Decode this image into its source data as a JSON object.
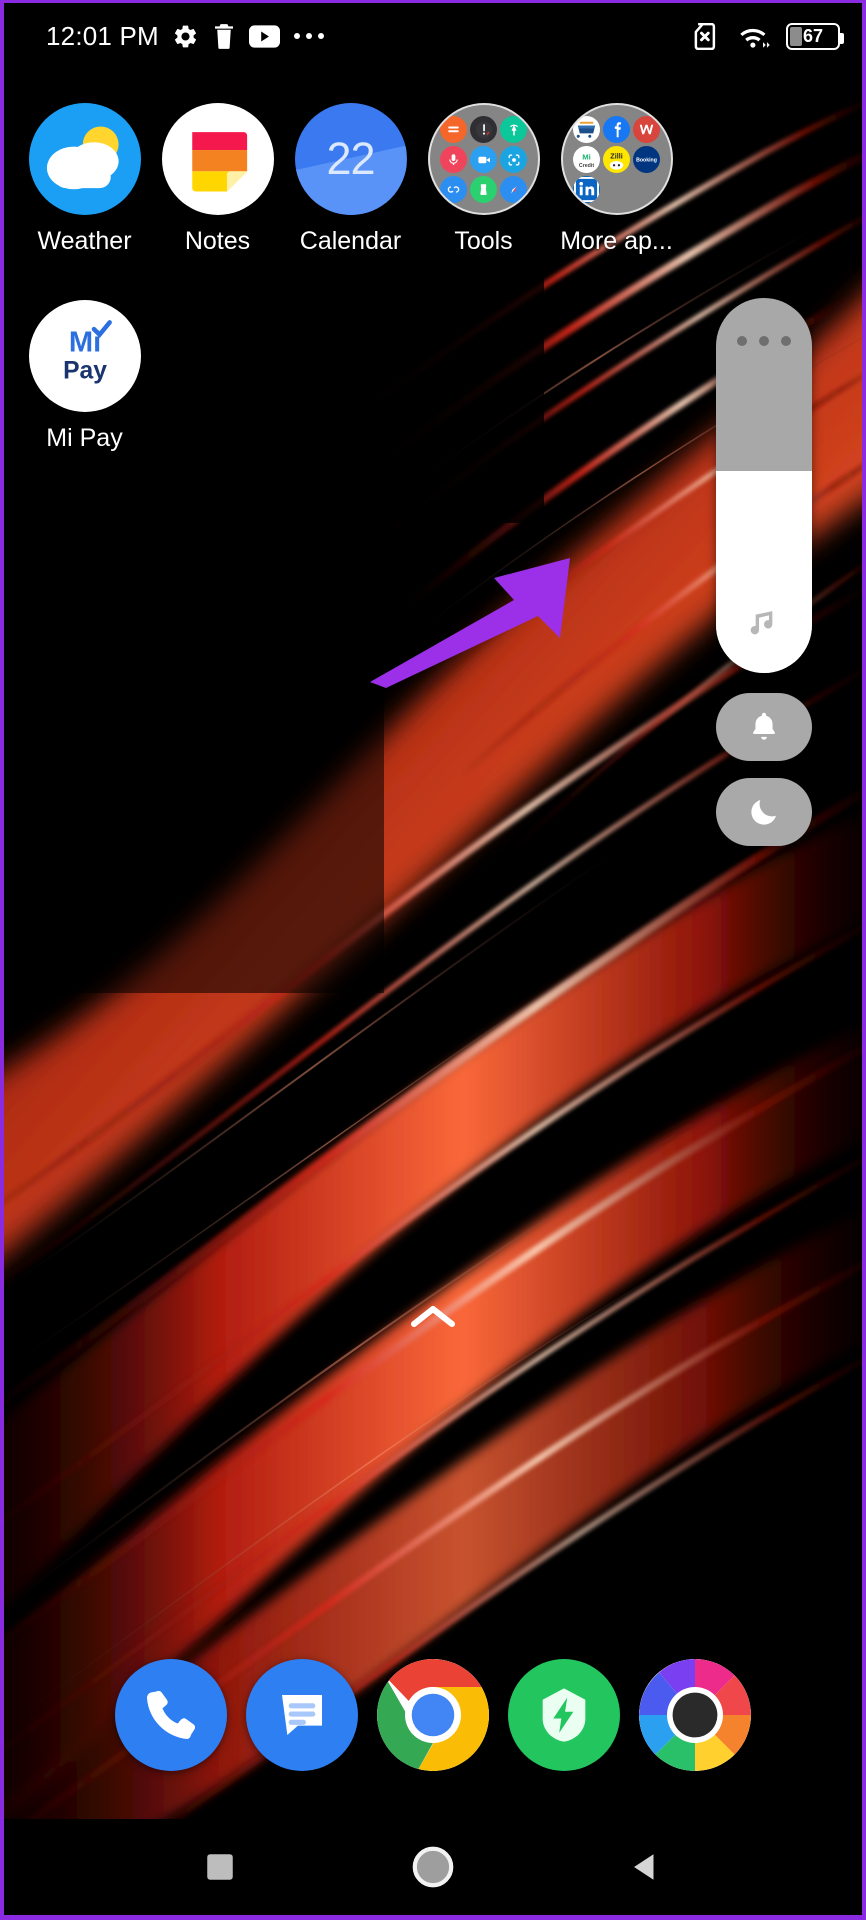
{
  "status_bar": {
    "time": "12:01 PM",
    "left_icons": [
      "gear-icon",
      "trash-icon",
      "youtube-icon",
      "more-dots-icon"
    ],
    "right_icons": [
      "no-sim-icon",
      "wifi-icon"
    ],
    "battery_level": "67"
  },
  "home_screen": {
    "apps": [
      {
        "label": "Weather",
        "icon": "weather-icon",
        "bg": "#1a9ff5"
      },
      {
        "label": "Notes",
        "icon": "notes-icon",
        "bg": "#ffffff"
      },
      {
        "label": "Calendar",
        "icon": "calendar-icon",
        "bg": "#4285f4",
        "day": "22"
      },
      {
        "label": "Tools",
        "icon": "folder-tools",
        "bg": "#d2d2d2"
      },
      {
        "label": "More ap...",
        "icon": "folder-more-apps",
        "bg": "#d2d2d2"
      },
      {
        "label": "Mi Pay",
        "icon": "mipay-icon",
        "bg": "#ffffff"
      }
    ],
    "tools_folder_items": [
      "mi-remote-icon",
      "compass-icon",
      "fm-radio-icon",
      "recorder-icon",
      "screen-recorder-icon",
      "scanner-icon",
      "mi-share-icon",
      "cleaner-icon",
      "mi-browser-icon"
    ],
    "more_apps_folder_items": [
      "amazon-icon",
      "facebook-icon",
      "wps-office-icon",
      "mi-credit-icon",
      "zilli-icon",
      "booking-icon",
      "linkedin-icon"
    ]
  },
  "volume_panel": {
    "slider_name": "media-volume-slider",
    "fill_percent": 54,
    "expand_label": "more-options-dots",
    "stream_icon": "music-note-icon",
    "buttons": [
      {
        "name": "ringer-button",
        "icon": "bell-icon"
      },
      {
        "name": "do-not-disturb-button",
        "icon": "moon-icon"
      }
    ]
  },
  "annotation": {
    "arrow_name": "purple-pointer-arrow",
    "arrow_color": "#9b30e8"
  },
  "page_indicator": {
    "icon": "chevron-up-icon"
  },
  "dock": {
    "apps": [
      {
        "label": "Phone",
        "icon": "phone-icon",
        "bg": "#2d7ff2"
      },
      {
        "label": "Messages",
        "icon": "messages-icon",
        "bg": "#2d7ff2"
      },
      {
        "label": "Chrome",
        "icon": "chrome-icon",
        "bg": "#ffffff"
      },
      {
        "label": "Security",
        "icon": "security-icon",
        "bg": "#22c55e"
      },
      {
        "label": "Gallery",
        "icon": "gallery-icon",
        "bg": "#ffffff"
      }
    ]
  },
  "nav_bar": {
    "buttons": [
      {
        "name": "recents-button",
        "icon": "square-icon"
      },
      {
        "name": "home-button",
        "icon": "circle-icon"
      },
      {
        "name": "back-button",
        "icon": "triangle-icon"
      }
    ]
  },
  "colors": {
    "wallpaper_red": "#c41a14",
    "wallpaper_bg": "#000000",
    "accent_purple": "#9b30e8",
    "slider_track": "#a8a8a8",
    "slider_fill": "#ffffff"
  }
}
